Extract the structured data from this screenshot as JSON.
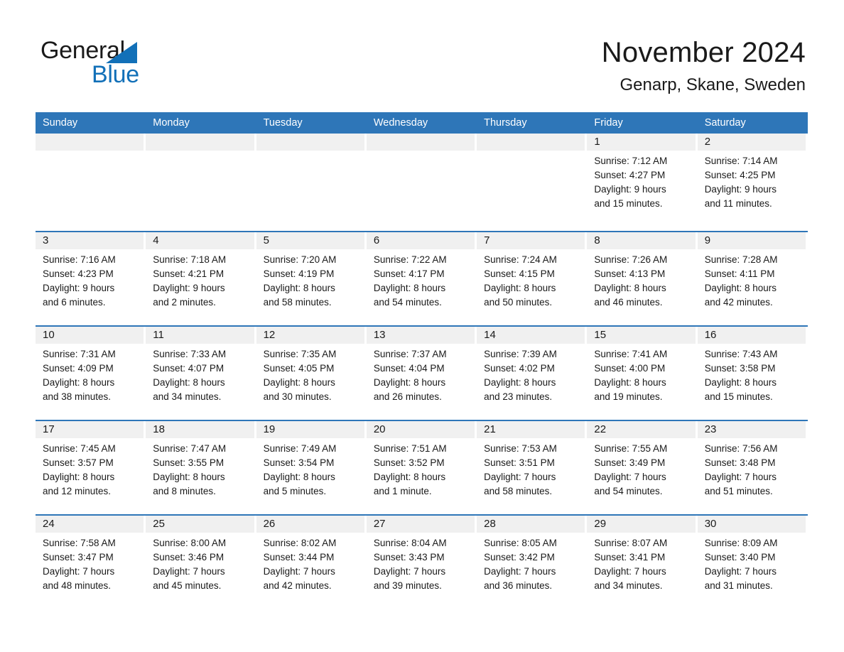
{
  "logo": {
    "line1": "General",
    "line2": "Blue",
    "accent_color": "#1270b8"
  },
  "header": {
    "title": "November 2024",
    "subtitle": "Genarp, Skane, Sweden",
    "header_bg_color": "#2e76b8",
    "day_band_color": "#f0f0f0"
  },
  "weekdays": [
    "Sunday",
    "Monday",
    "Tuesday",
    "Wednesday",
    "Thursday",
    "Friday",
    "Saturday"
  ],
  "weeks": [
    [
      {
        "day": "",
        "empty": true
      },
      {
        "day": "",
        "empty": true
      },
      {
        "day": "",
        "empty": true
      },
      {
        "day": "",
        "empty": true
      },
      {
        "day": "",
        "empty": true
      },
      {
        "day": "1",
        "sunrise": "Sunrise: 7:12 AM",
        "sunset": "Sunset: 4:27 PM",
        "daylight_line1": "Daylight: 9 hours",
        "daylight_line2": "and 15 minutes."
      },
      {
        "day": "2",
        "sunrise": "Sunrise: 7:14 AM",
        "sunset": "Sunset: 4:25 PM",
        "daylight_line1": "Daylight: 9 hours",
        "daylight_line2": "and 11 minutes."
      }
    ],
    [
      {
        "day": "3",
        "sunrise": "Sunrise: 7:16 AM",
        "sunset": "Sunset: 4:23 PM",
        "daylight_line1": "Daylight: 9 hours",
        "daylight_line2": "and 6 minutes."
      },
      {
        "day": "4",
        "sunrise": "Sunrise: 7:18 AM",
        "sunset": "Sunset: 4:21 PM",
        "daylight_line1": "Daylight: 9 hours",
        "daylight_line2": "and 2 minutes."
      },
      {
        "day": "5",
        "sunrise": "Sunrise: 7:20 AM",
        "sunset": "Sunset: 4:19 PM",
        "daylight_line1": "Daylight: 8 hours",
        "daylight_line2": "and 58 minutes."
      },
      {
        "day": "6",
        "sunrise": "Sunrise: 7:22 AM",
        "sunset": "Sunset: 4:17 PM",
        "daylight_line1": "Daylight: 8 hours",
        "daylight_line2": "and 54 minutes."
      },
      {
        "day": "7",
        "sunrise": "Sunrise: 7:24 AM",
        "sunset": "Sunset: 4:15 PM",
        "daylight_line1": "Daylight: 8 hours",
        "daylight_line2": "and 50 minutes."
      },
      {
        "day": "8",
        "sunrise": "Sunrise: 7:26 AM",
        "sunset": "Sunset: 4:13 PM",
        "daylight_line1": "Daylight: 8 hours",
        "daylight_line2": "and 46 minutes."
      },
      {
        "day": "9",
        "sunrise": "Sunrise: 7:28 AM",
        "sunset": "Sunset: 4:11 PM",
        "daylight_line1": "Daylight: 8 hours",
        "daylight_line2": "and 42 minutes."
      }
    ],
    [
      {
        "day": "10",
        "sunrise": "Sunrise: 7:31 AM",
        "sunset": "Sunset: 4:09 PM",
        "daylight_line1": "Daylight: 8 hours",
        "daylight_line2": "and 38 minutes."
      },
      {
        "day": "11",
        "sunrise": "Sunrise: 7:33 AM",
        "sunset": "Sunset: 4:07 PM",
        "daylight_line1": "Daylight: 8 hours",
        "daylight_line2": "and 34 minutes."
      },
      {
        "day": "12",
        "sunrise": "Sunrise: 7:35 AM",
        "sunset": "Sunset: 4:05 PM",
        "daylight_line1": "Daylight: 8 hours",
        "daylight_line2": "and 30 minutes."
      },
      {
        "day": "13",
        "sunrise": "Sunrise: 7:37 AM",
        "sunset": "Sunset: 4:04 PM",
        "daylight_line1": "Daylight: 8 hours",
        "daylight_line2": "and 26 minutes."
      },
      {
        "day": "14",
        "sunrise": "Sunrise: 7:39 AM",
        "sunset": "Sunset: 4:02 PM",
        "daylight_line1": "Daylight: 8 hours",
        "daylight_line2": "and 23 minutes."
      },
      {
        "day": "15",
        "sunrise": "Sunrise: 7:41 AM",
        "sunset": "Sunset: 4:00 PM",
        "daylight_line1": "Daylight: 8 hours",
        "daylight_line2": "and 19 minutes."
      },
      {
        "day": "16",
        "sunrise": "Sunrise: 7:43 AM",
        "sunset": "Sunset: 3:58 PM",
        "daylight_line1": "Daylight: 8 hours",
        "daylight_line2": "and 15 minutes."
      }
    ],
    [
      {
        "day": "17",
        "sunrise": "Sunrise: 7:45 AM",
        "sunset": "Sunset: 3:57 PM",
        "daylight_line1": "Daylight: 8 hours",
        "daylight_line2": "and 12 minutes."
      },
      {
        "day": "18",
        "sunrise": "Sunrise: 7:47 AM",
        "sunset": "Sunset: 3:55 PM",
        "daylight_line1": "Daylight: 8 hours",
        "daylight_line2": "and 8 minutes."
      },
      {
        "day": "19",
        "sunrise": "Sunrise: 7:49 AM",
        "sunset": "Sunset: 3:54 PM",
        "daylight_line1": "Daylight: 8 hours",
        "daylight_line2": "and 5 minutes."
      },
      {
        "day": "20",
        "sunrise": "Sunrise: 7:51 AM",
        "sunset": "Sunset: 3:52 PM",
        "daylight_line1": "Daylight: 8 hours",
        "daylight_line2": "and 1 minute."
      },
      {
        "day": "21",
        "sunrise": "Sunrise: 7:53 AM",
        "sunset": "Sunset: 3:51 PM",
        "daylight_line1": "Daylight: 7 hours",
        "daylight_line2": "and 58 minutes."
      },
      {
        "day": "22",
        "sunrise": "Sunrise: 7:55 AM",
        "sunset": "Sunset: 3:49 PM",
        "daylight_line1": "Daylight: 7 hours",
        "daylight_line2": "and 54 minutes."
      },
      {
        "day": "23",
        "sunrise": "Sunrise: 7:56 AM",
        "sunset": "Sunset: 3:48 PM",
        "daylight_line1": "Daylight: 7 hours",
        "daylight_line2": "and 51 minutes."
      }
    ],
    [
      {
        "day": "24",
        "sunrise": "Sunrise: 7:58 AM",
        "sunset": "Sunset: 3:47 PM",
        "daylight_line1": "Daylight: 7 hours",
        "daylight_line2": "and 48 minutes."
      },
      {
        "day": "25",
        "sunrise": "Sunrise: 8:00 AM",
        "sunset": "Sunset: 3:46 PM",
        "daylight_line1": "Daylight: 7 hours",
        "daylight_line2": "and 45 minutes."
      },
      {
        "day": "26",
        "sunrise": "Sunrise: 8:02 AM",
        "sunset": "Sunset: 3:44 PM",
        "daylight_line1": "Daylight: 7 hours",
        "daylight_line2": "and 42 minutes."
      },
      {
        "day": "27",
        "sunrise": "Sunrise: 8:04 AM",
        "sunset": "Sunset: 3:43 PM",
        "daylight_line1": "Daylight: 7 hours",
        "daylight_line2": "and 39 minutes."
      },
      {
        "day": "28",
        "sunrise": "Sunrise: 8:05 AM",
        "sunset": "Sunset: 3:42 PM",
        "daylight_line1": "Daylight: 7 hours",
        "daylight_line2": "and 36 minutes."
      },
      {
        "day": "29",
        "sunrise": "Sunrise: 8:07 AM",
        "sunset": "Sunset: 3:41 PM",
        "daylight_line1": "Daylight: 7 hours",
        "daylight_line2": "and 34 minutes."
      },
      {
        "day": "30",
        "sunrise": "Sunrise: 8:09 AM",
        "sunset": "Sunset: 3:40 PM",
        "daylight_line1": "Daylight: 7 hours",
        "daylight_line2": "and 31 minutes."
      }
    ]
  ]
}
